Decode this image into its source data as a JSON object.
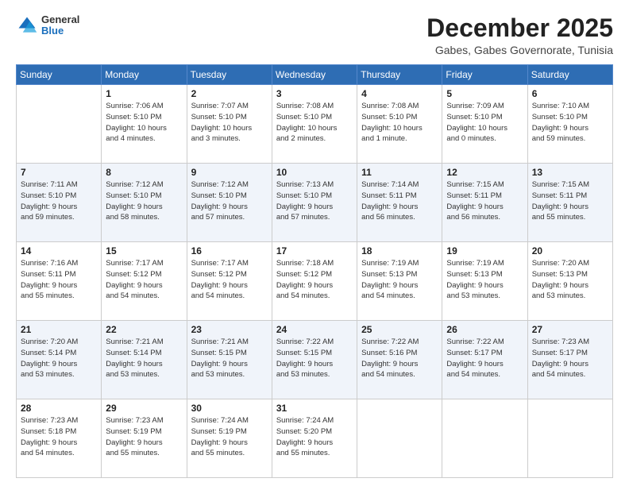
{
  "header": {
    "logo": {
      "general": "General",
      "blue": "Blue"
    },
    "title": "December 2025",
    "subtitle": "Gabes, Gabes Governorate, Tunisia"
  },
  "calendar": {
    "headers": [
      "Sunday",
      "Monday",
      "Tuesday",
      "Wednesday",
      "Thursday",
      "Friday",
      "Saturday"
    ],
    "weeks": [
      [
        {
          "day": "",
          "info": ""
        },
        {
          "day": "1",
          "info": "Sunrise: 7:06 AM\nSunset: 5:10 PM\nDaylight: 10 hours\nand 4 minutes."
        },
        {
          "day": "2",
          "info": "Sunrise: 7:07 AM\nSunset: 5:10 PM\nDaylight: 10 hours\nand 3 minutes."
        },
        {
          "day": "3",
          "info": "Sunrise: 7:08 AM\nSunset: 5:10 PM\nDaylight: 10 hours\nand 2 minutes."
        },
        {
          "day": "4",
          "info": "Sunrise: 7:08 AM\nSunset: 5:10 PM\nDaylight: 10 hours\nand 1 minute."
        },
        {
          "day": "5",
          "info": "Sunrise: 7:09 AM\nSunset: 5:10 PM\nDaylight: 10 hours\nand 0 minutes."
        },
        {
          "day": "6",
          "info": "Sunrise: 7:10 AM\nSunset: 5:10 PM\nDaylight: 9 hours\nand 59 minutes."
        }
      ],
      [
        {
          "day": "7",
          "info": "Sunrise: 7:11 AM\nSunset: 5:10 PM\nDaylight: 9 hours\nand 59 minutes."
        },
        {
          "day": "8",
          "info": "Sunrise: 7:12 AM\nSunset: 5:10 PM\nDaylight: 9 hours\nand 58 minutes."
        },
        {
          "day": "9",
          "info": "Sunrise: 7:12 AM\nSunset: 5:10 PM\nDaylight: 9 hours\nand 57 minutes."
        },
        {
          "day": "10",
          "info": "Sunrise: 7:13 AM\nSunset: 5:10 PM\nDaylight: 9 hours\nand 57 minutes."
        },
        {
          "day": "11",
          "info": "Sunrise: 7:14 AM\nSunset: 5:11 PM\nDaylight: 9 hours\nand 56 minutes."
        },
        {
          "day": "12",
          "info": "Sunrise: 7:15 AM\nSunset: 5:11 PM\nDaylight: 9 hours\nand 56 minutes."
        },
        {
          "day": "13",
          "info": "Sunrise: 7:15 AM\nSunset: 5:11 PM\nDaylight: 9 hours\nand 55 minutes."
        }
      ],
      [
        {
          "day": "14",
          "info": "Sunrise: 7:16 AM\nSunset: 5:11 PM\nDaylight: 9 hours\nand 55 minutes."
        },
        {
          "day": "15",
          "info": "Sunrise: 7:17 AM\nSunset: 5:12 PM\nDaylight: 9 hours\nand 54 minutes."
        },
        {
          "day": "16",
          "info": "Sunrise: 7:17 AM\nSunset: 5:12 PM\nDaylight: 9 hours\nand 54 minutes."
        },
        {
          "day": "17",
          "info": "Sunrise: 7:18 AM\nSunset: 5:12 PM\nDaylight: 9 hours\nand 54 minutes."
        },
        {
          "day": "18",
          "info": "Sunrise: 7:19 AM\nSunset: 5:13 PM\nDaylight: 9 hours\nand 54 minutes."
        },
        {
          "day": "19",
          "info": "Sunrise: 7:19 AM\nSunset: 5:13 PM\nDaylight: 9 hours\nand 53 minutes."
        },
        {
          "day": "20",
          "info": "Sunrise: 7:20 AM\nSunset: 5:13 PM\nDaylight: 9 hours\nand 53 minutes."
        }
      ],
      [
        {
          "day": "21",
          "info": "Sunrise: 7:20 AM\nSunset: 5:14 PM\nDaylight: 9 hours\nand 53 minutes."
        },
        {
          "day": "22",
          "info": "Sunrise: 7:21 AM\nSunset: 5:14 PM\nDaylight: 9 hours\nand 53 minutes."
        },
        {
          "day": "23",
          "info": "Sunrise: 7:21 AM\nSunset: 5:15 PM\nDaylight: 9 hours\nand 53 minutes."
        },
        {
          "day": "24",
          "info": "Sunrise: 7:22 AM\nSunset: 5:15 PM\nDaylight: 9 hours\nand 53 minutes."
        },
        {
          "day": "25",
          "info": "Sunrise: 7:22 AM\nSunset: 5:16 PM\nDaylight: 9 hours\nand 54 minutes."
        },
        {
          "day": "26",
          "info": "Sunrise: 7:22 AM\nSunset: 5:17 PM\nDaylight: 9 hours\nand 54 minutes."
        },
        {
          "day": "27",
          "info": "Sunrise: 7:23 AM\nSunset: 5:17 PM\nDaylight: 9 hours\nand 54 minutes."
        }
      ],
      [
        {
          "day": "28",
          "info": "Sunrise: 7:23 AM\nSunset: 5:18 PM\nDaylight: 9 hours\nand 54 minutes."
        },
        {
          "day": "29",
          "info": "Sunrise: 7:23 AM\nSunset: 5:19 PM\nDaylight: 9 hours\nand 55 minutes."
        },
        {
          "day": "30",
          "info": "Sunrise: 7:24 AM\nSunset: 5:19 PM\nDaylight: 9 hours\nand 55 minutes."
        },
        {
          "day": "31",
          "info": "Sunrise: 7:24 AM\nSunset: 5:20 PM\nDaylight: 9 hours\nand 55 minutes."
        },
        {
          "day": "",
          "info": ""
        },
        {
          "day": "",
          "info": ""
        },
        {
          "day": "",
          "info": ""
        }
      ]
    ]
  }
}
